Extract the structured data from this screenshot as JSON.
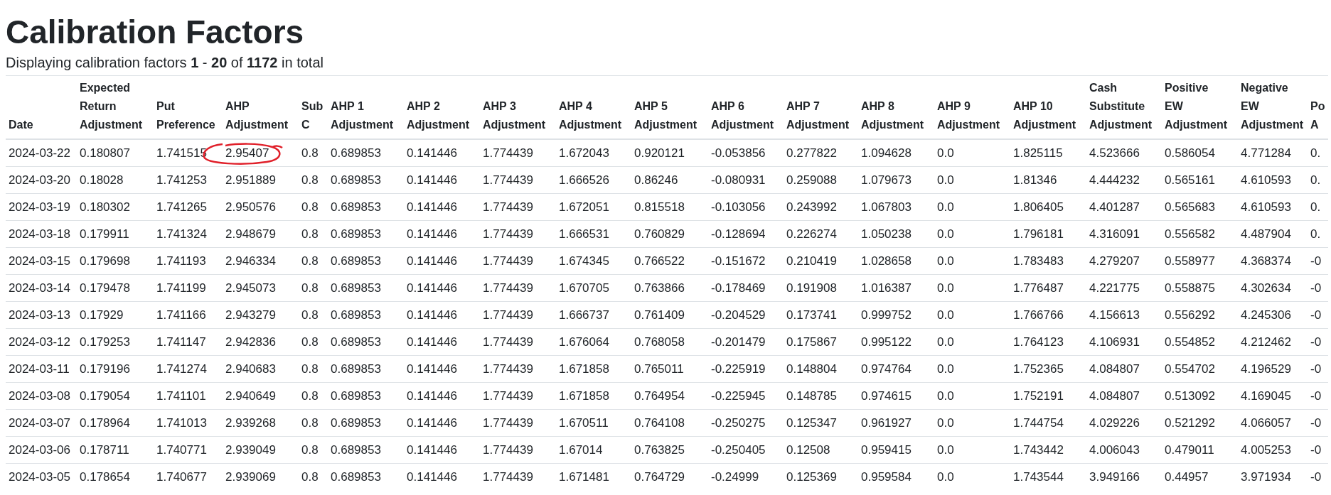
{
  "page": {
    "title": "Calibration Factors",
    "summary": "Displaying calibration factors **1** - **20** of **1172** in total"
  },
  "table": {
    "columns": [
      "Date",
      "Expected Return Adjustment",
      "Put Preference",
      "AHP Adjustment",
      "Sub C",
      "AHP 1 Adjustment",
      "AHP 2 Adjustment",
      "AHP 3 Adjustment",
      "AHP 4 Adjustment",
      "AHP 5 Adjustment",
      "AHP 6 Adjustment",
      "AHP 7 Adjustment",
      "AHP 8 Adjustment",
      "AHP 9 Adjustment",
      "AHP 10 Adjustment",
      "Cash Substitute Adjustment",
      "Positive EW Adjustment",
      "Negative EW Adjustment",
      "Po A"
    ],
    "rows": [
      [
        "2024-03-22",
        "0.180807",
        "1.741515",
        {
          "text": "2.95407",
          "circled": true
        },
        "0.8",
        "0.689853",
        "0.141446",
        "1.774439",
        "1.672043",
        "0.920121",
        "-0.053856",
        "0.277822",
        "1.094628",
        "0.0",
        "1.825115",
        "4.523666",
        "0.586054",
        "4.771284",
        "0."
      ],
      [
        "2024-03-20",
        "0.18028",
        "1.741253",
        "2.951889",
        "0.8",
        "0.689853",
        "0.141446",
        "1.774439",
        "1.666526",
        "0.86246",
        "-0.080931",
        "0.259088",
        "1.079673",
        "0.0",
        "1.81346",
        "4.444232",
        "0.565161",
        "4.610593",
        "0."
      ],
      [
        "2024-03-19",
        "0.180302",
        "1.741265",
        "2.950576",
        "0.8",
        "0.689853",
        "0.141446",
        "1.774439",
        "1.672051",
        "0.815518",
        "-0.103056",
        "0.243992",
        "1.067803",
        "0.0",
        "1.806405",
        "4.401287",
        "0.565683",
        "4.610593",
        "0."
      ],
      [
        "2024-03-18",
        "0.179911",
        "1.741324",
        "2.948679",
        "0.8",
        "0.689853",
        "0.141446",
        "1.774439",
        "1.666531",
        "0.760829",
        "-0.128694",
        "0.226274",
        "1.050238",
        "0.0",
        "1.796181",
        "4.316091",
        "0.556582",
        "4.487904",
        "0."
      ],
      [
        "2024-03-15",
        "0.179698",
        "1.741193",
        "2.946334",
        "0.8",
        "0.689853",
        "0.141446",
        "1.774439",
        "1.674345",
        "0.766522",
        "-0.151672",
        "0.210419",
        "1.028658",
        "0.0",
        "1.783483",
        "4.279207",
        "0.558977",
        "4.368374",
        "-0"
      ],
      [
        "2024-03-14",
        "0.179478",
        "1.741199",
        "2.945073",
        "0.8",
        "0.689853",
        "0.141446",
        "1.774439",
        "1.670705",
        "0.763866",
        "-0.178469",
        "0.191908",
        "1.016387",
        "0.0",
        "1.776487",
        "4.221775",
        "0.558875",
        "4.302634",
        "-0"
      ],
      [
        "2024-03-13",
        "0.17929",
        "1.741166",
        "2.943279",
        "0.8",
        "0.689853",
        "0.141446",
        "1.774439",
        "1.666737",
        "0.761409",
        "-0.204529",
        "0.173741",
        "0.999752",
        "0.0",
        "1.766766",
        "4.156613",
        "0.556292",
        "4.245306",
        "-0"
      ],
      [
        "2024-03-12",
        "0.179253",
        "1.741147",
        "2.942836",
        "0.8",
        "0.689853",
        "0.141446",
        "1.774439",
        "1.676064",
        "0.768058",
        "-0.201479",
        "0.175867",
        "0.995122",
        "0.0",
        "1.764123",
        "4.106931",
        "0.554852",
        "4.212462",
        "-0"
      ],
      [
        "2024-03-11",
        "0.179196",
        "1.741274",
        "2.940683",
        "0.8",
        "0.689853",
        "0.141446",
        "1.774439",
        "1.671858",
        "0.765011",
        "-0.225919",
        "0.148804",
        "0.974764",
        "0.0",
        "1.752365",
        "4.084807",
        "0.554702",
        "4.196529",
        "-0"
      ],
      [
        "2024-03-08",
        "0.179054",
        "1.741101",
        "2.940649",
        "0.8",
        "0.689853",
        "0.141446",
        "1.774439",
        "1.671858",
        "0.764954",
        "-0.225945",
        "0.148785",
        "0.974615",
        "0.0",
        "1.752191",
        "4.084807",
        "0.513092",
        "4.169045",
        "-0"
      ],
      [
        "2024-03-07",
        "0.178964",
        "1.741013",
        "2.939268",
        "0.8",
        "0.689853",
        "0.141446",
        "1.774439",
        "1.670511",
        "0.764108",
        "-0.250275",
        "0.125347",
        "0.961927",
        "0.0",
        "1.744754",
        "4.029226",
        "0.521292",
        "4.066057",
        "-0"
      ],
      [
        "2024-03-06",
        "0.178711",
        "1.740771",
        "2.939049",
        "0.8",
        "0.689853",
        "0.141446",
        "1.774439",
        "1.67014",
        "0.763825",
        "-0.250405",
        "0.12508",
        "0.959415",
        "0.0",
        "1.743442",
        "4.006043",
        "0.479011",
        "4.005253",
        "-0"
      ],
      [
        "2024-03-05",
        "0.178654",
        "1.740677",
        "2.939069",
        "0.8",
        "0.689853",
        "0.141446",
        "1.774439",
        "1.671481",
        "0.764729",
        "-0.24999",
        "0.125369",
        "0.959584",
        "0.0",
        "1.743544",
        "3.949166",
        "0.44957",
        "3.971934",
        "-0"
      ]
    ]
  }
}
